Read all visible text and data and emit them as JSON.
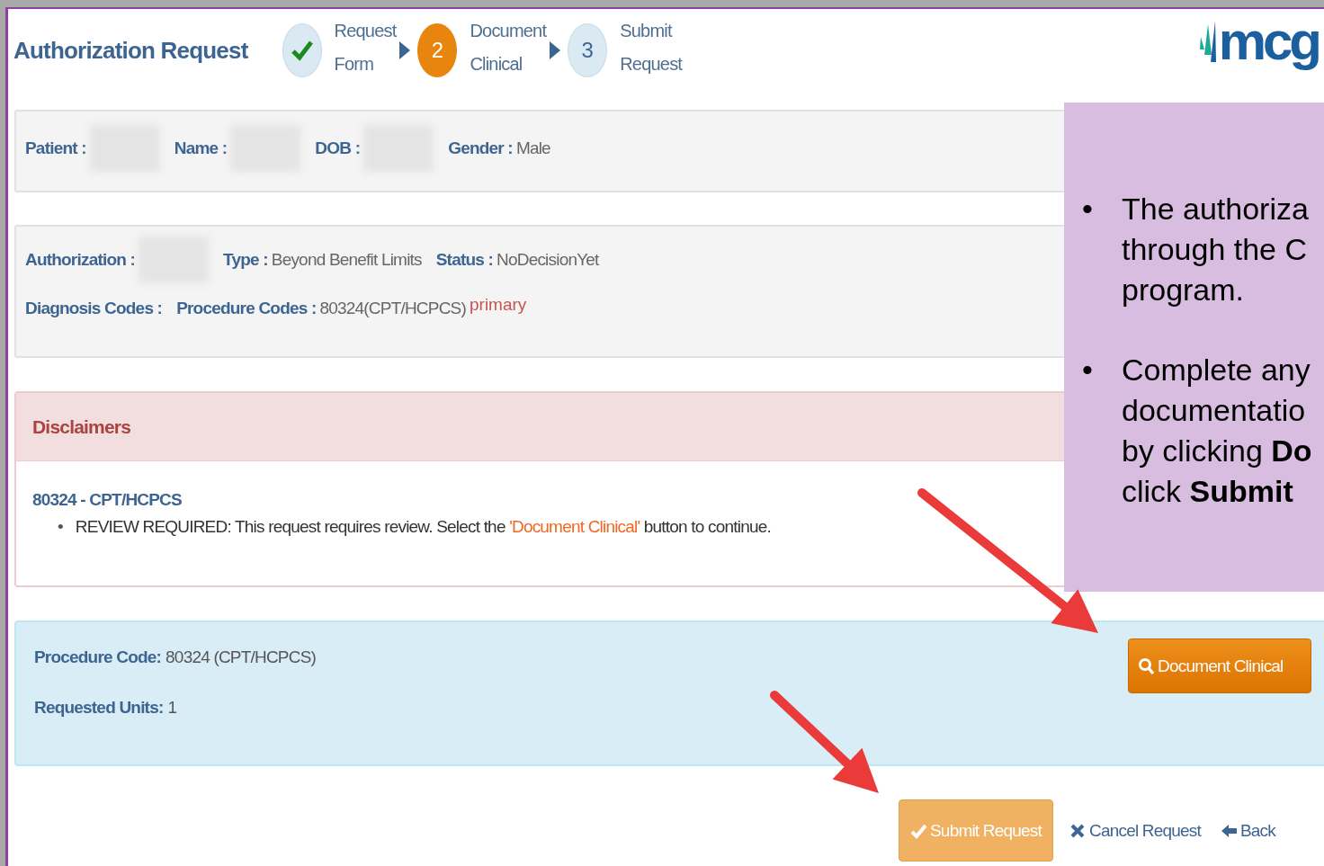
{
  "header": {
    "title": "Authorization Request",
    "logo_text": "mcg"
  },
  "steps": [
    {
      "label": "Request\nForm",
      "completed": true,
      "current": false
    },
    {
      "label": "Document\nClinical",
      "number": "2",
      "completed": false,
      "current": true
    },
    {
      "label": "Submit\nRequest",
      "number": "3",
      "completed": false,
      "current": false
    }
  ],
  "patient_panel": {
    "fields": [
      {
        "label": "Patient :",
        "redacted": true
      },
      {
        "label": "Name :",
        "redacted": true
      },
      {
        "label": "DOB :",
        "redacted": true
      },
      {
        "label": "Gender :",
        "value": "Male",
        "redacted": false
      }
    ]
  },
  "authorization_panel": {
    "rows": [
      [
        {
          "label": "Authorization :",
          "redacted": true
        },
        {
          "label": "Type :",
          "value": "Beyond Benefit Limits",
          "redacted": false
        },
        {
          "label": "Status :",
          "value": "NoDecisionYet",
          "redacted": false
        }
      ],
      [
        {
          "label": "Diagnosis Codes :",
          "redacted": false
        },
        {
          "label": "Procedure Codes :",
          "value": "80324(CPT/HCPCS)",
          "note": "primary",
          "redacted": false
        }
      ]
    ]
  },
  "disclaimers": {
    "title": "Disclaimers",
    "code": "80324 - CPT/HCPCS",
    "items": [
      {
        "marker": "•",
        "before": "REVIEW REQUIRED: This request requires review. Select the ",
        "highlight": "'Document Clinical'",
        "after": " button to continue."
      }
    ]
  },
  "procedure": {
    "lines": [
      {
        "label": "Procedure Code:",
        "value": "80324 (CPT/HCPCS)"
      },
      {
        "label": "Requested Units:",
        "value": "1"
      }
    ],
    "button": "Document Clinical"
  },
  "actions": [
    {
      "label": "Submit Request",
      "kind": "primary"
    },
    {
      "label": "Cancel Request",
      "kind": "cancel"
    },
    {
      "label": "Back",
      "kind": "back"
    }
  ],
  "callout": {
    "bullets": [
      {
        "marker": "•",
        "text": "The authoriza\nthrough the C\nprogram."
      },
      {
        "marker": "•",
        "text": "Complete any\ndocumentatio\nby clicking **Do**\nclick **Submit**"
      }
    ]
  }
}
